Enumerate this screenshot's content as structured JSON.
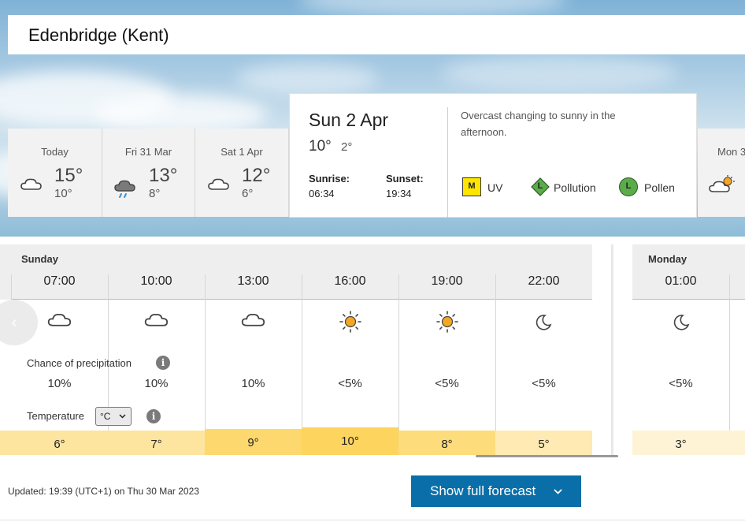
{
  "location": {
    "name": "Edenbridge (Kent)"
  },
  "day_tabs": [
    {
      "label": "Today",
      "high": "15°",
      "low": "10°",
      "icon": "cloud-icon"
    },
    {
      "label": "Fri 31 Mar",
      "high": "13°",
      "low": "8°",
      "icon": "rain-cloud-icon"
    },
    {
      "label": "Sat 1 Apr",
      "high": "12°",
      "low": "6°",
      "icon": "cloud-icon"
    },
    {
      "label": "Mon 3",
      "icon": "sun-cloud-icon"
    }
  ],
  "selected_day": {
    "date": "Sun 2 Apr",
    "high": "10°",
    "low": "2°",
    "sunrise_label": "Sunrise:",
    "sunrise": "06:34",
    "sunset_label": "Sunset:",
    "sunset": "19:34",
    "description": "Overcast changing to sunny in the afternoon.",
    "uv_badge": "M",
    "uv_label": "UV",
    "pollution_badge": "L",
    "pollution_label": "Pollution",
    "pollen_badge": "L",
    "pollen_label": "Pollen"
  },
  "hourly": {
    "day_name": "Sunday",
    "precip_label": "Chance of precipitation",
    "temp_label": "Temperature",
    "unit": "°C",
    "hours": [
      {
        "time": "07:00",
        "icon": "cloud-icon",
        "precip": "10%",
        "temp": "6°"
      },
      {
        "time": "10:00",
        "icon": "cloud-icon",
        "precip": "10%",
        "temp": "7°"
      },
      {
        "time": "13:00",
        "icon": "cloud-icon",
        "precip": "10%",
        "temp": "9°"
      },
      {
        "time": "16:00",
        "icon": "sun-icon",
        "precip": "<5%",
        "temp": "10°"
      },
      {
        "time": "19:00",
        "icon": "sun-icon",
        "precip": "<5%",
        "temp": "8°"
      },
      {
        "time": "22:00",
        "icon": "moon-icon",
        "precip": "<5%",
        "temp": "5°"
      }
    ],
    "next_day_name": "Monday",
    "next_hours": [
      {
        "time": "01:00",
        "icon": "moon-icon",
        "precip": "<5%",
        "temp": "3°"
      }
    ]
  },
  "footer": {
    "updated": "Updated: 19:39 (UTC+1) on Thu 30 Mar 2023",
    "button": "Show full forecast"
  },
  "colors": {
    "accent": "#0a6fa8",
    "uv_yellow": "#ffe500",
    "pollution_green": "#5aac4b",
    "sun_orange": "#f5a623"
  }
}
